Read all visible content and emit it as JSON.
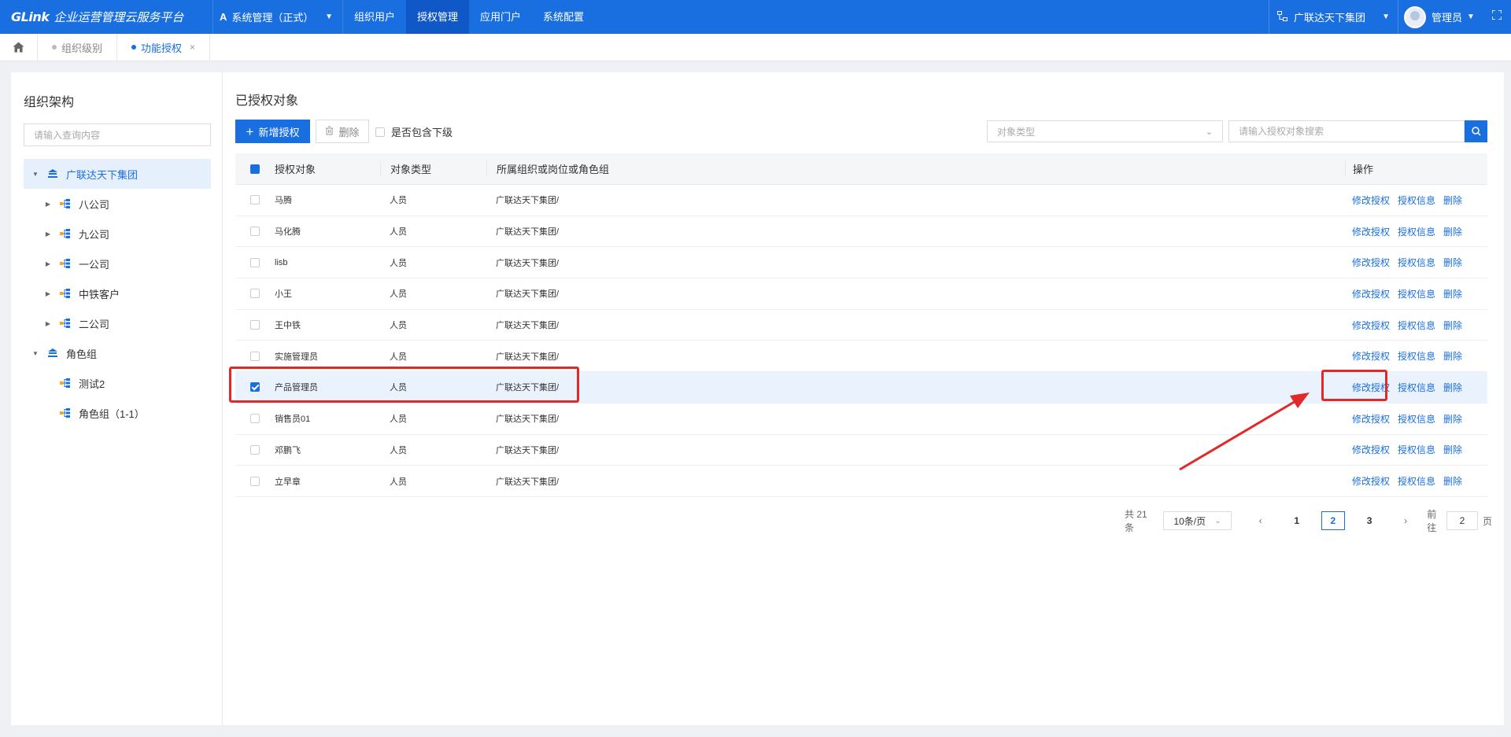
{
  "header": {
    "logo_mark": "GLink",
    "logo_text": "企业运营管理云服务平台",
    "system_select": "系统管理（正式）",
    "nav": [
      {
        "label": "组织用户"
      },
      {
        "label": "授权管理"
      },
      {
        "label": "应用门户"
      },
      {
        "label": "系统配置"
      }
    ],
    "org_select": "广联达天下集团",
    "user_name": "管理员"
  },
  "tabs": [
    {
      "label": "组织级别"
    },
    {
      "label": "功能授权"
    }
  ],
  "left": {
    "title": "组织架构",
    "search_placeholder": "请输入查询内容",
    "tree": [
      {
        "label": "广联达天下集团"
      },
      {
        "label": "八公司"
      },
      {
        "label": "九公司"
      },
      {
        "label": "一公司"
      },
      {
        "label": "中铁客户"
      },
      {
        "label": "二公司"
      },
      {
        "label": "角色组"
      },
      {
        "label": "测试2"
      },
      {
        "label": "角色组（1-1）"
      }
    ]
  },
  "main": {
    "title": "已授权对象",
    "add_button": "新增授权",
    "delete_button": "删除",
    "include_sub": "是否包含下级",
    "type_select_placeholder": "对象类型",
    "search_placeholder": "请输入授权对象搜索",
    "columns": [
      "授权对象",
      "对象类型",
      "所属组织或岗位或角色组",
      "操作"
    ],
    "actions": [
      "修改授权",
      "授权信息",
      "删除"
    ],
    "rows": [
      {
        "name": "马腾",
        "type": "人员",
        "org": "广联达天下集团/"
      },
      {
        "name": "马化腾",
        "type": "人员",
        "org": "广联达天下集团/"
      },
      {
        "name": "lisb",
        "type": "人员",
        "org": "广联达天下集团/"
      },
      {
        "name": "小王",
        "type": "人员",
        "org": "广联达天下集团/"
      },
      {
        "name": "王中铁",
        "type": "人员",
        "org": "广联达天下集团/"
      },
      {
        "name": "实施管理员",
        "type": "人员",
        "org": "广联达天下集团/"
      },
      {
        "name": "产品管理员",
        "type": "人员",
        "org": "广联达天下集团/"
      },
      {
        "name": "销售员01",
        "type": "人员",
        "org": "广联达天下集团/"
      },
      {
        "name": "邓鹏飞",
        "type": "人员",
        "org": "广联达天下集团/"
      },
      {
        "name": "立早章",
        "type": "人员",
        "org": "广联达天下集团/"
      }
    ]
  },
  "pager": {
    "total": "共 21 条",
    "page_size": "10条/页",
    "pages": [
      "1",
      "2",
      "3"
    ],
    "goto_label": "前往",
    "goto_value": "2",
    "goto_suffix": "页"
  },
  "colors": {
    "primary": "#1a6fe0",
    "annotation": "#e02a2a"
  }
}
